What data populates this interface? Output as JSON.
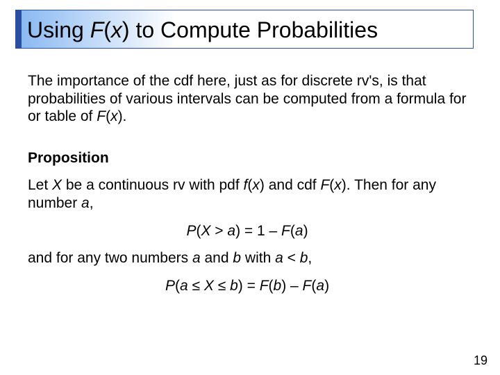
{
  "title": {
    "t1": "Using ",
    "F": "F",
    "lp": "(",
    "x": "x",
    "rp": ")",
    "t2": " to Compute Probabilities"
  },
  "p1": {
    "a": "The importance of the cdf here, just as for discrete rv's, is that probabilities of various intervals can be computed from a formula for or table of ",
    "F": "F",
    "lp": "(",
    "x": "x",
    "rp": ").",
    "end": ""
  },
  "prop": "Proposition",
  "p2": {
    "a": "Let ",
    "X": "X",
    "b": " be a continuous rv with pdf ",
    "f": "f",
    "lp1": "(",
    "x1": "x",
    "rp1": ")",
    "c": " and cdf ",
    "F": "F",
    "lp2": "(",
    "x2": "x",
    "rp2": "). Then for any number ",
    "aVar": "a",
    "comma": ","
  },
  "eq1": {
    "P": "P",
    "lp": "(",
    "X": "X",
    "gt": " > ",
    "a": "a",
    "rp": ") = 1 – ",
    "F": "F",
    "lp2": "(",
    "a2": "a",
    "rp2": ")"
  },
  "p3": {
    "a": "and for any two numbers ",
    "aVar": "a",
    "b": " and ",
    "bVar": "b",
    "c": " with ",
    "aVar2": "a",
    "lt": " < ",
    "bVar2": "b",
    "comma": ","
  },
  "eq2": {
    "P": "P",
    "lp": "(",
    "a": "a",
    "le1": " ≤ ",
    "X": "X",
    "le2": " ≤ ",
    "b": "b",
    "rp": ") = ",
    "F1": "F",
    "lp2": "(",
    "b2": "b",
    "rp2": ") – ",
    "F2": "F",
    "lp3": "(",
    "a2": "a",
    "rp3": ")"
  },
  "page": "19"
}
